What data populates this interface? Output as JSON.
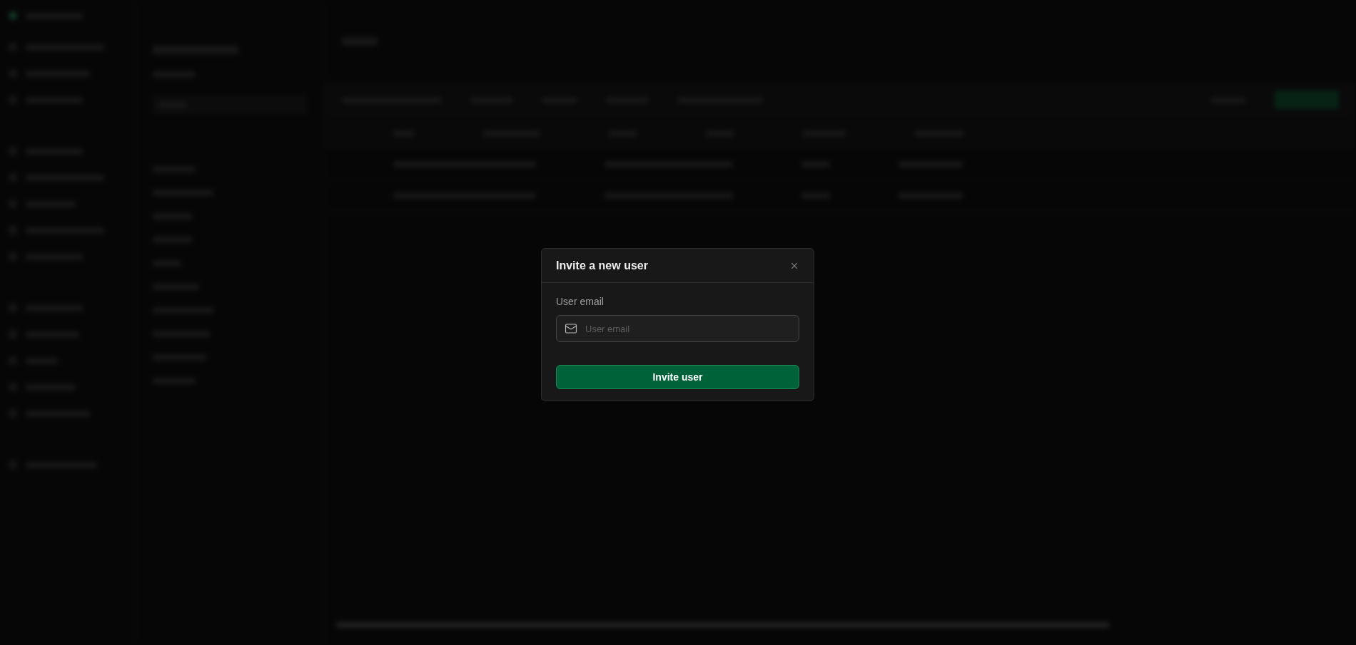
{
  "dialog": {
    "title": "Invite a new user",
    "field": {
      "label": "User email",
      "placeholder": "User email"
    },
    "submit_button": "Invite user"
  }
}
